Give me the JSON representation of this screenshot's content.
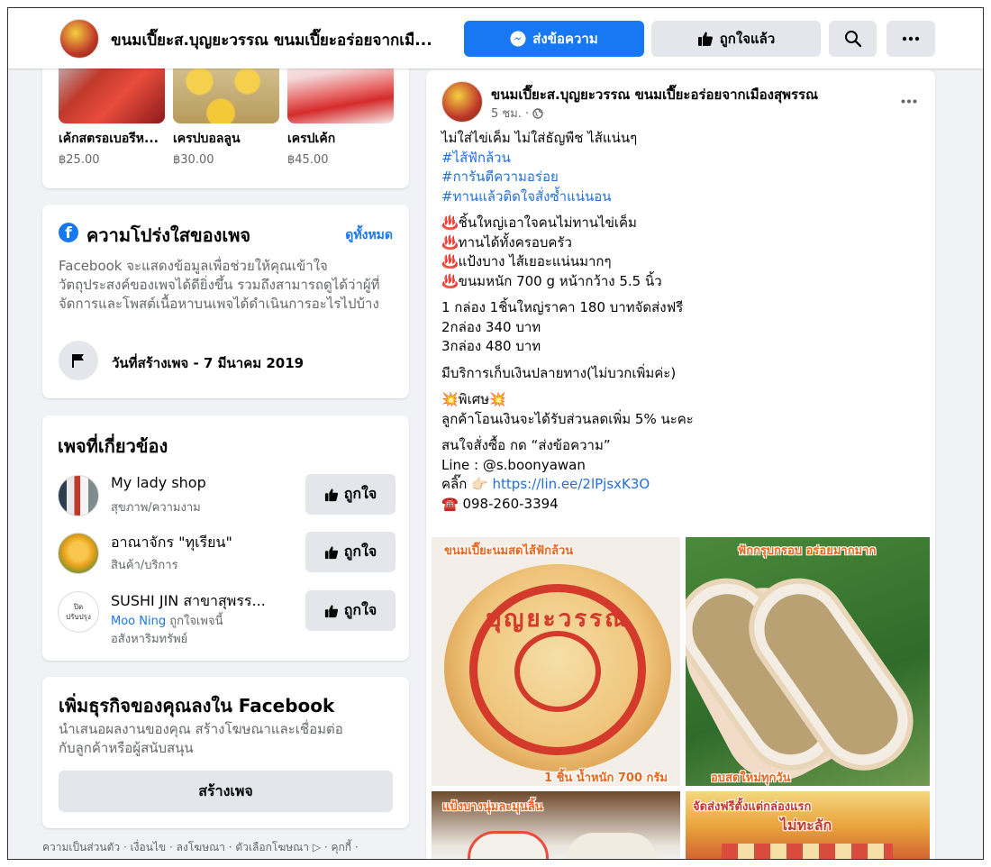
{
  "header": {
    "page_name": "ขนมเปี๊ยะส.บุญยะวรรณ ขนมเปี๊ยะอร่อยจากเมื...",
    "message_label": "ส่งข้อความ",
    "liked_label": "ถูกใจแล้ว"
  },
  "shop": {
    "items": [
      {
        "name": "เค้กสตรอเบอรีห...",
        "price": "฿25.00"
      },
      {
        "name": "เครปบอลลูน",
        "price": "฿30.00"
      },
      {
        "name": "เครปเค้ก",
        "price": "฿45.00"
      }
    ]
  },
  "transparency": {
    "title": "ความโปร่งใสของเพจ",
    "see_all": "ดูทั้งหมด",
    "description": "Facebook จะแสดงข้อมูลเพื่อช่วยให้คุณเข้าใจวัตถุประสงค์ของเพจได้ดียิ่งขึ้น รวมถึงสามารถดูได้ว่าผู้ที่จัดการและโพสต์เนื้อหาบนเพจได้ดำเนินการอะไรไปบ้าง",
    "created": "วันที่สร้างเพจ - 7 มีนาคม 2019"
  },
  "related": {
    "title": "เพจที่เกี่ยวข้อง",
    "like_label": "ถูกใจ",
    "pages": [
      {
        "name": "My lady shop",
        "category": "สุขภาพ/ความงาม"
      },
      {
        "name": "อาณาจักร \"ทุเรียน\"",
        "category": "สินค้า/บริการ"
      },
      {
        "name": "SUSHI JIN สาขาสุพรร...",
        "friend": "Moo Ning",
        "friend_suffix": " ถูกใจเพจนี้",
        "category": "อสังหาริมทรัพย์",
        "avatar_text_1": "ปิด",
        "avatar_text_2": "ปรับปรุง"
      }
    ]
  },
  "business": {
    "title": "เพิ่มธุรกิจของคุณลงใน Facebook",
    "description": "นำเสนอผลงานของคุณ สร้างโฆษณาและเชื่อมต่อกับลูกค้าหรือผู้สนับสนุน",
    "create_label": "สร้างเพจ"
  },
  "footer": "ความเป็นส่วนตัว · เงื่อนไข · ลงโฆษณา · ตัวเลือกโฆษณา ▷ · คุกกี้ ·",
  "post": {
    "author": "ขนมเปี๊ยะส.บุญยะวรรณ ขนมเปี๊ยะอร่อยจากเมืองสุพรรณ",
    "time": "5 ชม. ·",
    "line1": "ไม่ใส่ไข่เค็ม ไม่ใส่ธัญพืช ไส้แน่นๆ",
    "tags": [
      "#ไส้ฟักล้วน",
      "#การันตีความอร่อย",
      "#ทานแล้วติดใจสั่งซ้ำแน่นอน"
    ],
    "features": [
      "♨️ชิ้นใหญ่เอาใจคนไม่ทานไข่เค็ม",
      "♨️ทานได้ทั้งครอบครัว",
      "♨️แป้งบาง ไส้เยอะแน่นมากๆ",
      "♨️ขนมหนัก 700 g หน้ากว้าง 5.5 นิ้ว"
    ],
    "prices": [
      "1 กล่อง 1ชิ้นใหญ่ราคา 180 บาทจัดส่งฟรี",
      "2กล่อง 340 บาท",
      "3กล่อง 480 บาท"
    ],
    "cod": "มีบริการเก็บเงินปลายทาง(ไม่บวกเพิ่มค่ะ)",
    "special_title": "💥พิเศษ💥",
    "special_text": "ลูกค้าโอนเงินจะได้รับส่วนลดเพิ่ม 5% นะคะ",
    "order_title": "สนใจสั่งซื้อ กด “ส่งข้อความ”",
    "line_id": " Line : @s.boonyawan",
    "click_prefix": "คลิ๊ก 👉🏻 ",
    "link": "https://lin.ee/2lPjsxK3O",
    "phone": "☎️ 098-260-3394",
    "photo_captions": [
      "ขนมเปี๊ยะนมสดไส้ฟักล้วน",
      "1 ชิ้น น้ำหนัก 700 กรัม",
      "ฟักกรุบกรอบ อร่อยมากมาก",
      "อบสดใหม่ทุกวัน",
      "แป้งบางนุ่มละมุนลิ้น",
      "จัดส่งฟรีตั้งแต่กล่องแรก",
      "ไม่ทะลัก"
    ],
    "stamp_text": "บุญยะวรรณ"
  }
}
